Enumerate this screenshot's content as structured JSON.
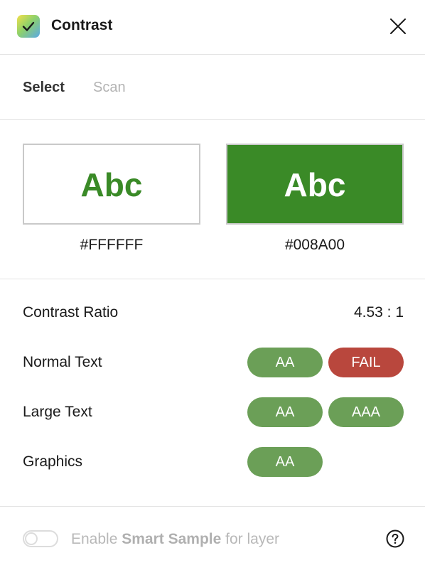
{
  "header": {
    "title": "Contrast",
    "app_icon": "checkmark-app-icon",
    "close_icon": "close-icon"
  },
  "tabs": [
    {
      "label": "Select",
      "active": true
    },
    {
      "label": "Scan",
      "active": false
    }
  ],
  "swatches": {
    "sample_text": "Abc",
    "background": {
      "hex": "#FFFFFF",
      "text_color": "#3a8a27",
      "fill": "#ffffff"
    },
    "foreground": {
      "hex": "#008A00",
      "text_color": "#ffffff",
      "fill": "#3a8a27"
    }
  },
  "results": {
    "contrast_ratio_label": "Contrast Ratio",
    "contrast_ratio_value": "4.53 : 1",
    "rows": [
      {
        "label": "Normal Text",
        "badges": [
          {
            "text": "AA",
            "status": "pass"
          },
          {
            "text": "FAIL",
            "status": "fail"
          }
        ]
      },
      {
        "label": "Large Text",
        "badges": [
          {
            "text": "AA",
            "status": "pass"
          },
          {
            "text": "AAA",
            "status": "pass"
          }
        ]
      },
      {
        "label": "Graphics",
        "badges": [
          {
            "text": "AA",
            "status": "pass"
          }
        ]
      }
    ]
  },
  "footer": {
    "toggle_on": false,
    "text_before": "Enable ",
    "text_bold": "Smart Sample",
    "text_after": " for layer",
    "help_icon": "help-icon"
  },
  "colors": {
    "pass": "#6b9f57",
    "fail": "#b9473d",
    "accent_green": "#3a8a27"
  }
}
